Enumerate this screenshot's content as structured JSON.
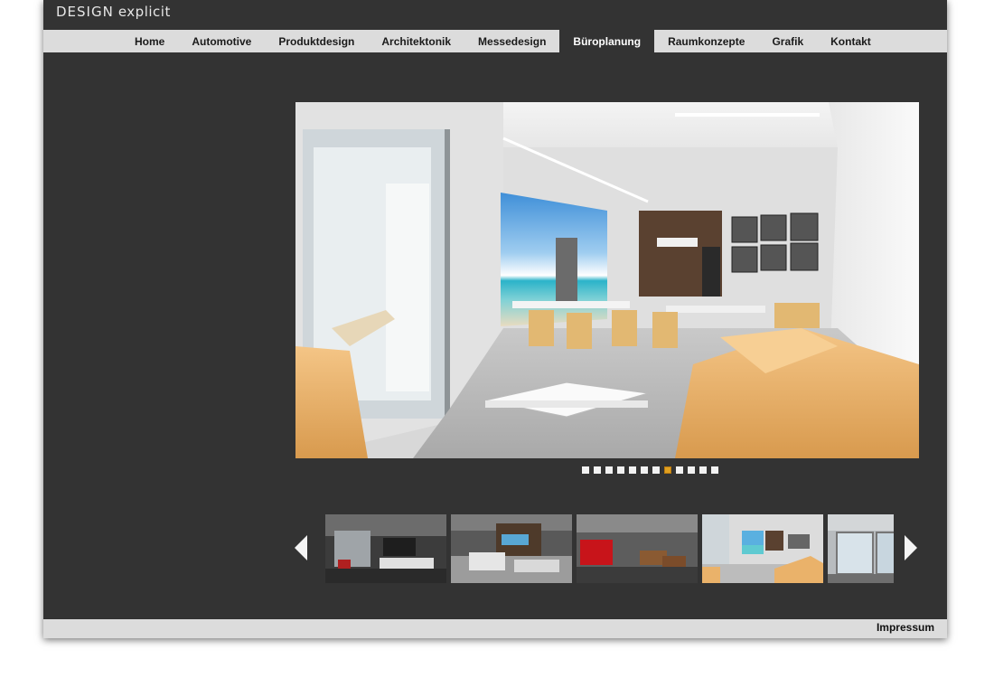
{
  "header": {
    "logo_word1": "DESIGN",
    "logo_word2": "explicit"
  },
  "nav": {
    "items": [
      {
        "label": "Home"
      },
      {
        "label": "Automotive"
      },
      {
        "label": "Produktdesign"
      },
      {
        "label": "Architektonik"
      },
      {
        "label": "Messedesign"
      },
      {
        "label": "Büroplanung",
        "active": true
      },
      {
        "label": "Raumkonzepte"
      },
      {
        "label": "Grafik"
      },
      {
        "label": "Kontakt"
      }
    ]
  },
  "slideshow": {
    "slide_count": 12,
    "active_slide": 8,
    "active_color": "#e0a020"
  },
  "thumbnails": {
    "items": [
      {
        "name": "thumb-office-dark-lounge"
      },
      {
        "name": "thumb-office-desks"
      },
      {
        "name": "thumb-office-red-cabinet"
      },
      {
        "name": "thumb-office-beach-lounge",
        "active": true
      },
      {
        "name": "thumb-office-glass-room"
      }
    ],
    "prev_icon": "triangle-left-icon",
    "next_icon": "triangle-right-icon"
  },
  "footer": {
    "impressum": "Impressum"
  },
  "colors": {
    "page_bg": "#333333",
    "nav_bg": "#dcdcdc",
    "nav_active_bg": "#333333"
  }
}
